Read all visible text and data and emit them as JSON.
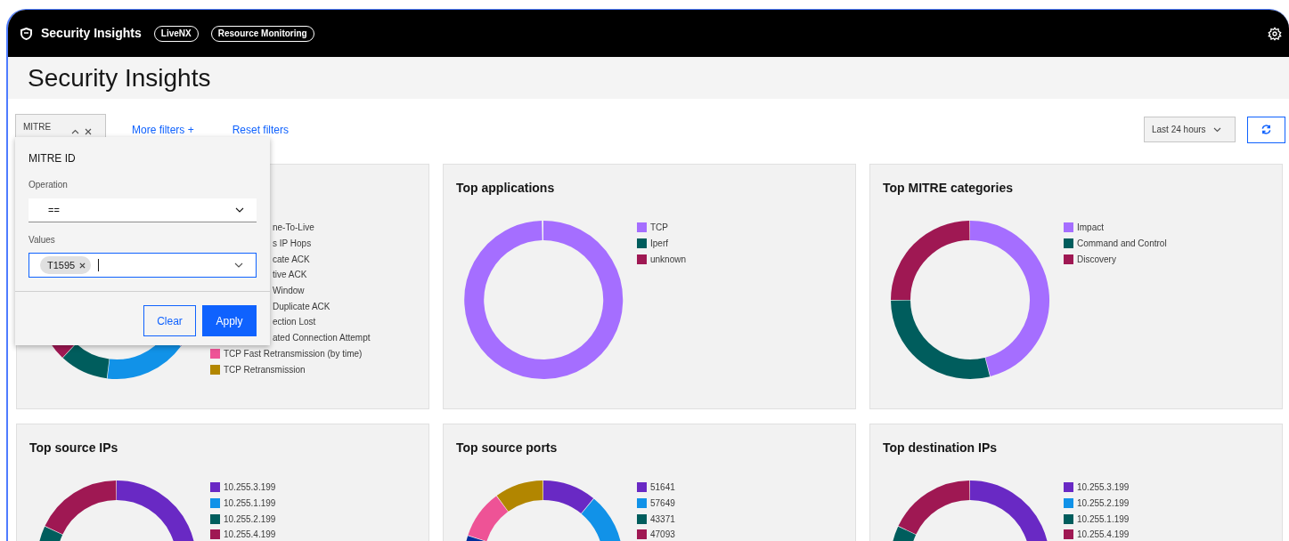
{
  "top_bar": {
    "title": "Security Insights",
    "pills": [
      "LiveNX",
      "Resource Monitoring"
    ]
  },
  "page_title": "Security Insights",
  "filters": {
    "chip": "MITRE",
    "more": "More filters +",
    "reset": "Reset filters",
    "time_range": "Last 24 hours"
  },
  "filter_popup": {
    "title": "MITRE ID",
    "operation_label": "Operation",
    "operation": "==",
    "values_label": "Values",
    "tags": [
      "T1595"
    ],
    "buttons": [
      "Clear",
      "Apply"
    ]
  },
  "cards": [
    {
      "legend": [
        {
          "kind": "covered",
          "label": "ne-To-Live"
        },
        {
          "kind": "covered",
          "label": "s IP Hops"
        },
        {
          "kind": "covered",
          "label": "cate ACK"
        },
        {
          "kind": "covered",
          "label": "tive ACK"
        },
        {
          "kind": "covered",
          "label": "Window"
        },
        {
          "kind": "covered",
          "label": "Duplicate ACK"
        },
        {
          "kind": "covered",
          "label": "ection Lost"
        },
        {
          "kind": "covered",
          "label": "ated Connection Attempt"
        },
        {
          "kind": "swatch",
          "label": "TCP Fast Retransmission (by time)",
          "color": "#ee5396"
        },
        {
          "kind": "swatch",
          "label": "TCP Retransmission",
          "color": "#b28600"
        }
      ]
    },
    {
      "title": "Top applications",
      "legend": [
        {
          "kind": "swatch",
          "label": "TCP",
          "color": "#a56eff"
        },
        {
          "kind": "swatch",
          "label": "Iperf",
          "color": "#005d5d"
        },
        {
          "kind": "swatch",
          "label": "unknown",
          "color": "#9f1853"
        }
      ]
    },
    {
      "title": "Top MITRE categories",
      "legend": [
        {
          "kind": "swatch",
          "label": "Impact",
          "color": "#a56eff"
        },
        {
          "kind": "swatch",
          "label": "Command and Control",
          "color": "#005d5d"
        },
        {
          "kind": "swatch",
          "label": "Discovery",
          "color": "#9f1853"
        }
      ]
    },
    {
      "title": "Top source IPs",
      "legend": [
        {
          "kind": "swatch",
          "label": "10.255.3.199",
          "color": "#6929c4"
        },
        {
          "kind": "swatch",
          "label": "10.255.1.199",
          "color": "#1192e8"
        },
        {
          "kind": "swatch",
          "label": "10.255.2.199",
          "color": "#005d5d"
        },
        {
          "kind": "swatch",
          "label": "10.255.4.199",
          "color": "#9f1853"
        }
      ]
    },
    {
      "title": "Top source ports",
      "legend": [
        {
          "kind": "swatch",
          "label": "51641",
          "color": "#6929c4"
        },
        {
          "kind": "swatch",
          "label": "57649",
          "color": "#1192e8"
        },
        {
          "kind": "swatch",
          "label": "43371",
          "color": "#005d5d"
        },
        {
          "kind": "swatch",
          "label": "47093",
          "color": "#9f1853"
        }
      ]
    },
    {
      "title": "Top destination IPs",
      "legend": [
        {
          "kind": "swatch",
          "label": "10.255.3.199",
          "color": "#6929c4"
        },
        {
          "kind": "swatch",
          "label": "10.255.2.199",
          "color": "#1192e8"
        },
        {
          "kind": "swatch",
          "label": "10.255.1.199",
          "color": "#005d5d"
        },
        {
          "kind": "swatch",
          "label": "10.255.4.199",
          "color": "#9f1853"
        }
      ]
    }
  ]
}
